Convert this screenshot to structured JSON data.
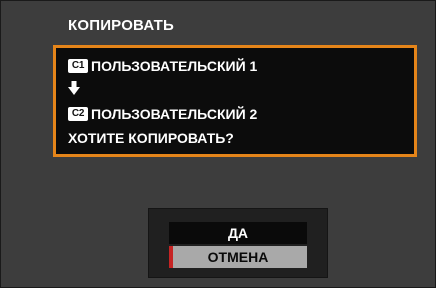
{
  "screen": {
    "title": "КОПИРОВАТЬ"
  },
  "message": {
    "source_badge": "C1",
    "source_label": "ПОЛЬЗОВАТЕЛЬСКИЙ 1",
    "arrow_icon": "arrow-down-icon",
    "target_badge": "C2",
    "target_label": "ПОЛЬЗОВАТЕЛЬСКИЙ 2",
    "question": "ХОТИТЕ КОПИРОВАТЬ?"
  },
  "dialog": {
    "options": [
      {
        "label": "ДА",
        "selected": false
      },
      {
        "label": "ОТМЕНА",
        "selected": true
      }
    ]
  },
  "colors": {
    "background": "#3d3d3d",
    "message_border": "#e5851a",
    "selected_option": "#a9a9a9",
    "selection_marker": "#c62424"
  }
}
